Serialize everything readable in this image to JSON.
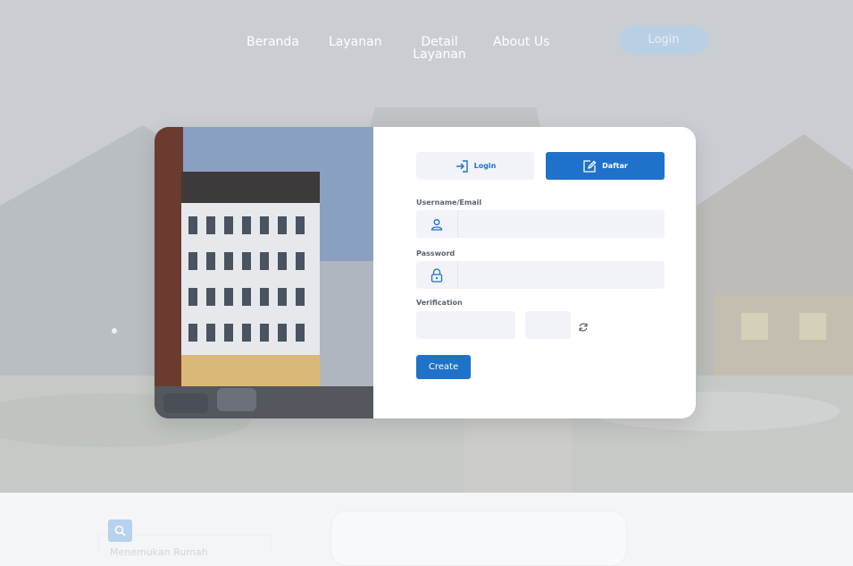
{
  "nav": {
    "links": [
      "Beranda",
      "Layanan",
      "Detail Layanan",
      "About Us"
    ],
    "detail_line1": "Detail",
    "detail_line2": "Layanan",
    "login_label": "Login"
  },
  "auth": {
    "tab_login": "Login",
    "tab_register": "Daftar",
    "username_label": "Username/Email",
    "username_value": "",
    "password_label": "Password",
    "password_value": "",
    "verification_label": "Verification",
    "verification_value": "",
    "create_label": "Create"
  },
  "bottom": {
    "search_placeholder": "Menemukan Rumah"
  },
  "colors": {
    "primary": "#1f72c9",
    "field_bg": "#f1f3f8"
  }
}
